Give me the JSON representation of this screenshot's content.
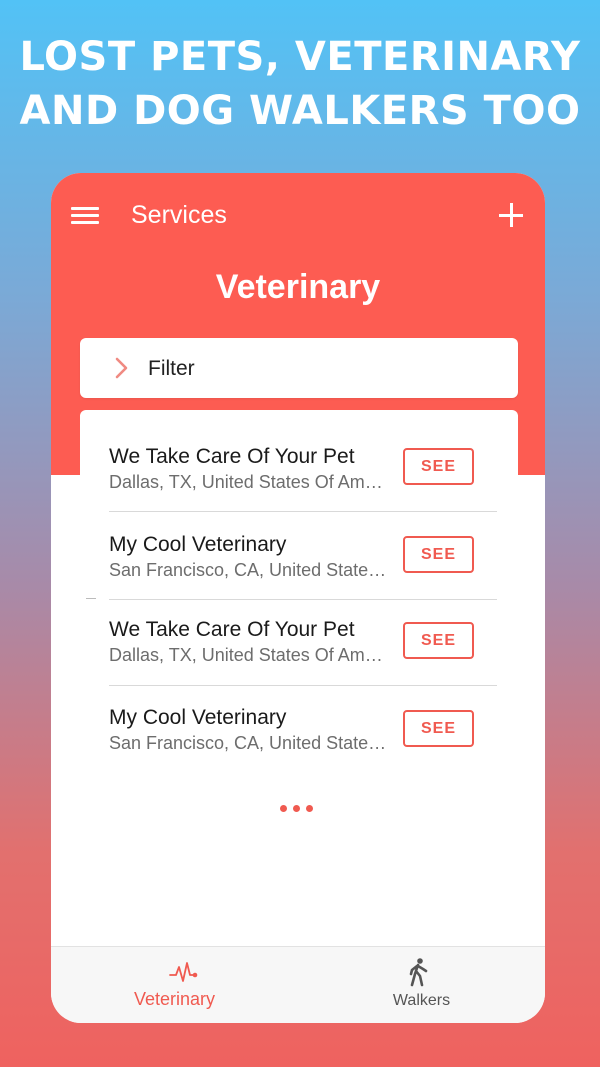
{
  "headline": {
    "line1": "LOST PETS, VETERINARY",
    "line2": "AND DOG WALKERS TOO"
  },
  "app_bar": {
    "title": "Services",
    "menu_icon": "hamburger-menu-icon",
    "add_icon": "plus-icon"
  },
  "page_title": "Veterinary",
  "filter": {
    "label": "Filter",
    "icon": "chevron-right-icon"
  },
  "services": [
    {
      "name": "We Take Care Of Your Pet",
      "address": "Dallas, TX, United States Of America",
      "action": "SEE"
    },
    {
      "name": "My Cool Veterinary",
      "address": "San Francisco, CA, United States Of America",
      "action": "SEE"
    },
    {
      "name": "We Take Care Of Your Pet",
      "address": "Dallas, TX, United States Of America",
      "action": "SEE"
    },
    {
      "name": "My Cool Veterinary",
      "address": "San Francisco, CA, United States Of America",
      "action": "SEE"
    }
  ],
  "bottom_nav": [
    {
      "label": "Veterinary",
      "icon": "heartbeat-icon",
      "active": true
    },
    {
      "label": "Walkers",
      "icon": "walking-person-icon",
      "active": false
    }
  ],
  "colors": {
    "accent": "#fd5c52",
    "button_red": "#f05a50",
    "gradient_top": "#52c2f6",
    "gradient_bottom": "#ef625f"
  }
}
